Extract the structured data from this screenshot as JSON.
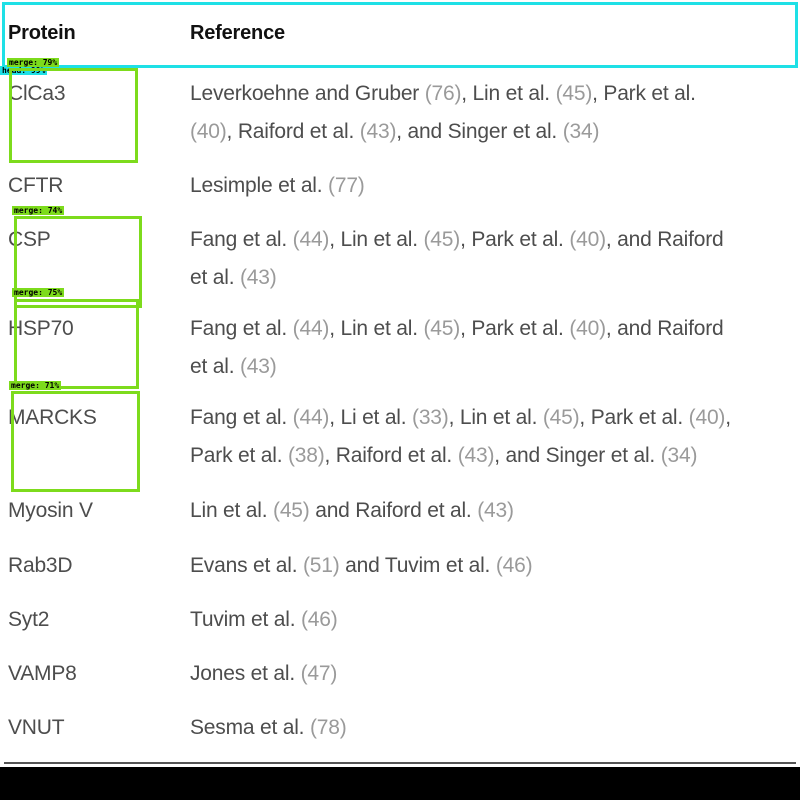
{
  "table": {
    "headers": {
      "protein": "Protein",
      "reference": "Reference"
    },
    "rows": [
      {
        "protein": "ClCa3",
        "lines": [
          [
            {
              "t": "Leverkoehne and Gruber "
            },
            {
              "t": "(76)",
              "c": 1
            },
            {
              "t": ", Lin et al. "
            },
            {
              "t": "(45)",
              "c": 1
            },
            {
              "t": ", Park et al."
            }
          ],
          [
            {
              "t": "(40)",
              "c": 1
            },
            {
              "t": ", Raiford et al. "
            },
            {
              "t": "(43)",
              "c": 1
            },
            {
              "t": ", and Singer et al. "
            },
            {
              "t": "(34)",
              "c": 1
            }
          ]
        ]
      },
      {
        "protein": "CFTR",
        "lines": [
          [
            {
              "t": "Lesimple et al. "
            },
            {
              "t": "(77)",
              "c": 1
            }
          ]
        ]
      },
      {
        "protein": "CSP",
        "lines": [
          [
            {
              "t": "Fang et al. "
            },
            {
              "t": "(44)",
              "c": 1
            },
            {
              "t": ", Lin et al. "
            },
            {
              "t": "(45)",
              "c": 1
            },
            {
              "t": ", Park et al. "
            },
            {
              "t": "(40)",
              "c": 1
            },
            {
              "t": ", and Raiford"
            }
          ],
          [
            {
              "t": "et al. "
            },
            {
              "t": "(43)",
              "c": 1
            }
          ]
        ]
      },
      {
        "protein": "HSP70",
        "lines": [
          [
            {
              "t": "Fang et al. "
            },
            {
              "t": "(44)",
              "c": 1
            },
            {
              "t": ", Lin et al. "
            },
            {
              "t": "(45)",
              "c": 1
            },
            {
              "t": ", Park et al. "
            },
            {
              "t": "(40)",
              "c": 1
            },
            {
              "t": ", and Raiford"
            }
          ],
          [
            {
              "t": "et al. "
            },
            {
              "t": "(43)",
              "c": 1
            }
          ]
        ]
      },
      {
        "protein": "MARCKS",
        "lines": [
          [
            {
              "t": "Fang et al. "
            },
            {
              "t": "(44)",
              "c": 1
            },
            {
              "t": ", Li et al. "
            },
            {
              "t": "(33)",
              "c": 1
            },
            {
              "t": ", Lin et al. "
            },
            {
              "t": "(45)",
              "c": 1
            },
            {
              "t": ", Park et al. "
            },
            {
              "t": "(40)",
              "c": 1
            },
            {
              "t": ","
            }
          ],
          [
            {
              "t": "Park et al. "
            },
            {
              "t": "(38)",
              "c": 1
            },
            {
              "t": ", Raiford et al. "
            },
            {
              "t": "(43)",
              "c": 1
            },
            {
              "t": ", and Singer et al. "
            },
            {
              "t": "(34)",
              "c": 1
            }
          ]
        ]
      },
      {
        "protein": "Myosin V",
        "lines": [
          [
            {
              "t": "Lin et al. "
            },
            {
              "t": "(45)",
              "c": 1
            },
            {
              "t": " and Raiford et al. "
            },
            {
              "t": "(43)",
              "c": 1
            }
          ]
        ]
      },
      {
        "protein": "Rab3D",
        "lines": [
          [
            {
              "t": "Evans et al. "
            },
            {
              "t": "(51)",
              "c": 1
            },
            {
              "t": " and Tuvim et al. "
            },
            {
              "t": "(46)",
              "c": 1
            }
          ]
        ]
      },
      {
        "protein": "Syt2",
        "lines": [
          [
            {
              "t": "Tuvim et al. "
            },
            {
              "t": "(46)",
              "c": 1
            }
          ]
        ]
      },
      {
        "protein": "VAMP8",
        "lines": [
          [
            {
              "t": "Jones et al. "
            },
            {
              "t": "(47)",
              "c": 1
            }
          ]
        ]
      },
      {
        "protein": "VNUT",
        "lines": [
          [
            {
              "t": "Sesma et al. "
            },
            {
              "t": "(78)",
              "c": 1
            }
          ]
        ]
      }
    ]
  },
  "detections": [
    {
      "label": "head: 99%",
      "kind": "head"
    },
    {
      "label": "merge: 79%",
      "kind": "merge"
    },
    {
      "label": "merge: 74%",
      "kind": "merge"
    },
    {
      "label": "merge: 75%",
      "kind": "merge"
    },
    {
      "label": "merge: 71%",
      "kind": "merge"
    }
  ],
  "colors": {
    "merge_box": "#7ddb1c",
    "head_box": "#1ee0e6",
    "citation": "#9a9a9a"
  }
}
